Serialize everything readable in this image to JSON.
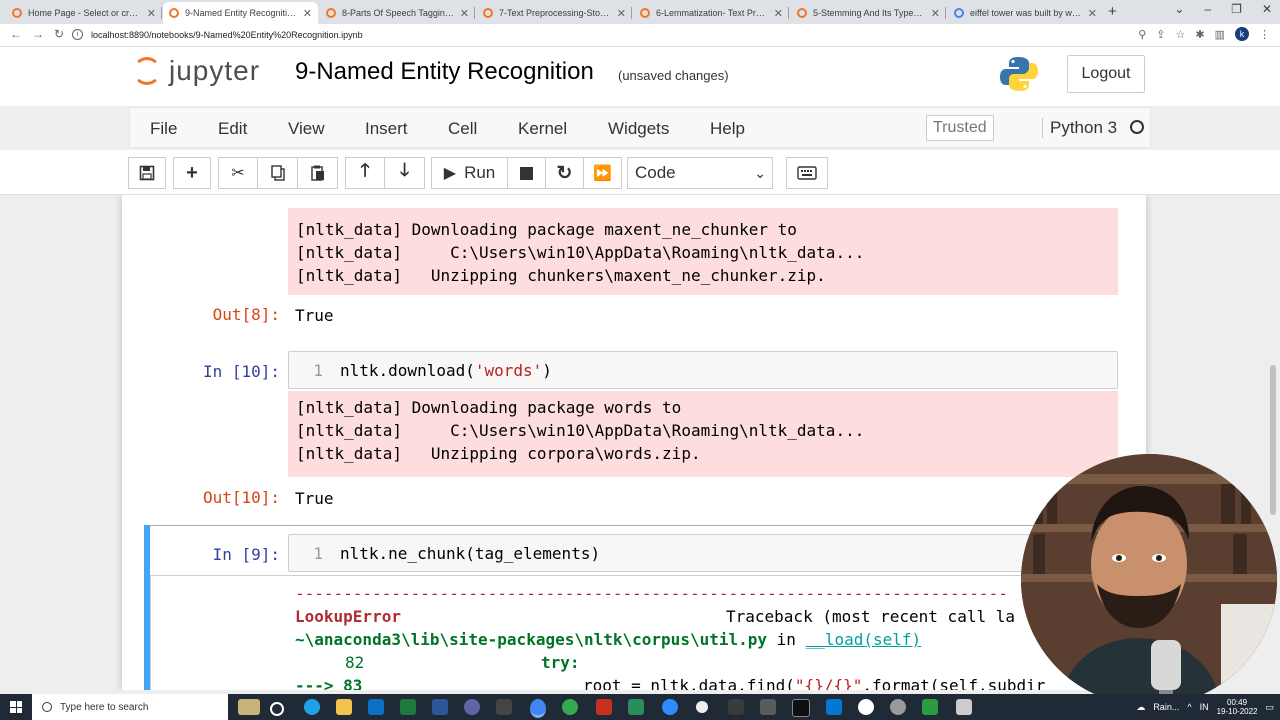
{
  "browser": {
    "tabs": [
      {
        "label": "Home Page - Select or create a",
        "active": false
      },
      {
        "label": "9-Named Entity Recognition - Ju",
        "active": true
      },
      {
        "label": "8-Parts Of Speech Tagging - Jup",
        "active": false
      },
      {
        "label": "7-Text Preprocessing-Stopwords",
        "active": false
      },
      {
        "label": "6-Lemmatization- Text Preproce",
        "active": false
      },
      {
        "label": "5-Stemming And Its Types- Text",
        "active": false
      },
      {
        "label": "eiffel tower was built by whom",
        "active": false
      }
    ],
    "new_tab": "+",
    "url": "localhost:8890/notebooks/9-Named%20Entity%20Recognition.ipynb",
    "profile_initial": "k"
  },
  "jupyter": {
    "logo_text": "jupyter",
    "notebook_title": "9-Named Entity Recognition",
    "save_status": "(unsaved changes)",
    "logout_label": "Logout",
    "menus": [
      "File",
      "Edit",
      "View",
      "Insert",
      "Cell",
      "Kernel",
      "Widgets",
      "Help"
    ],
    "trusted_label": "Trusted",
    "kernel_name": "Python 3",
    "run_label": "Run",
    "cell_type": "Code"
  },
  "cells": {
    "cell8": {
      "stderr": "[nltk_data] Downloading package maxent_ne_chunker to\n[nltk_data]     C:\\Users\\win10\\AppData\\Roaming\\nltk_data...\n[nltk_data]   Unzipping chunkers\\maxent_ne_chunker.zip.",
      "out_prompt": "Out[8]:",
      "out_value": "True"
    },
    "cell10": {
      "in_prompt": "In [10]:",
      "line_no": "1",
      "code_func": "nltk.download(",
      "code_arg": "'words'",
      "code_close": ")",
      "stderr": "[nltk_data] Downloading package words to\n[nltk_data]     C:\\Users\\win10\\AppData\\Roaming\\nltk_data...\n[nltk_data]   Unzipping corpora\\words.zip.",
      "out_prompt": "Out[10]:",
      "out_value": "True"
    },
    "cell9": {
      "in_prompt": "In [9]:",
      "line_no": "1",
      "code": "nltk.ne_chunk(tag_elements)",
      "tb_dashes": "--------------------------------------------------------------------------",
      "tb_error": "LookupError",
      "tb_header": "Traceback (most recent call la",
      "tb_path": "~\\anaconda3\\lib\\site-packages\\nltk\\corpus\\util.py",
      "tb_in": "in",
      "tb_func": "__load(self)",
      "tb_l82_no": "82",
      "tb_l82_code": "try:",
      "tb_l83_arrow": "---> 83",
      "tb_l83_code_a": "root = nltk.data.find(",
      "tb_l83_code_s": "\"{}/{}\"",
      "tb_l83_code_b": ".format(self.subdir"
    }
  },
  "taskbar": {
    "search_placeholder": "Type here to search",
    "weather": "Rain...",
    "time": "00:49",
    "date": "19-10-2022",
    "lang": "IN"
  }
}
